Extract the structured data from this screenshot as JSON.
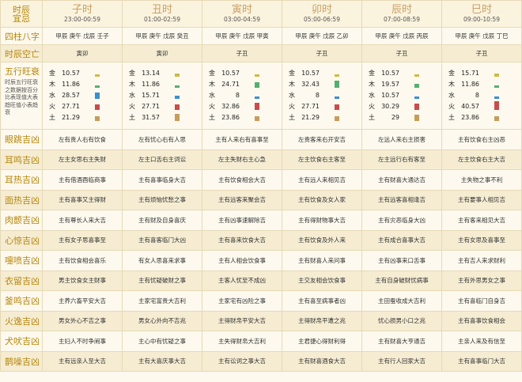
{
  "corner_label": [
    "时辰",
    "宜忌"
  ],
  "hours": [
    {
      "name": "子时",
      "range": "23:00-00:59",
      "bazi": "甲辰 庚午 戊辰 壬子",
      "kongwang": "寅卯",
      "wuxing": [
        {
          "el": "金",
          "v": "10.57",
          "c": "#cdbb46",
          "f": 0.26
        },
        {
          "el": "木",
          "v": "11.86",
          "c": "#55b06e",
          "f": 0.29
        },
        {
          "el": "水",
          "v": "28.57",
          "c": "#3b8fd1",
          "f": 0.7
        },
        {
          "el": "火",
          "v": "27.71",
          "c": "#c84c4c",
          "f": 0.68
        },
        {
          "el": "土",
          "v": "21.29",
          "c": "#c89c5c",
          "f": 0.52
        }
      ]
    },
    {
      "name": "丑时",
      "range": "01:00-02:59",
      "bazi": "甲辰 庚午 戊辰 癸丑",
      "kongwang": "寅卯",
      "wuxing": [
        {
          "el": "金",
          "v": "13.14",
          "c": "#cdbb46",
          "f": 0.32
        },
        {
          "el": "木",
          "v": "11.86",
          "c": "#55b06e",
          "f": 0.29
        },
        {
          "el": "水",
          "v": "15.71",
          "c": "#3b8fd1",
          "f": 0.39
        },
        {
          "el": "火",
          "v": "27.71",
          "c": "#c84c4c",
          "f": 0.68
        },
        {
          "el": "土",
          "v": "31.57",
          "c": "#c89c5c",
          "f": 0.78
        }
      ]
    },
    {
      "name": "寅时",
      "range": "03:00-04:59",
      "bazi": "甲辰 庚午 戊辰 甲寅",
      "kongwang": "子丑",
      "wuxing": [
        {
          "el": "金",
          "v": "10.57",
          "c": "#cdbb46",
          "f": 0.26
        },
        {
          "el": "木",
          "v": "24.71",
          "c": "#55b06e",
          "f": 0.61
        },
        {
          "el": "水",
          "v": "8",
          "c": "#3b8fd1",
          "f": 0.2
        },
        {
          "el": "火",
          "v": "32.86",
          "c": "#c84c4c",
          "f": 0.81
        },
        {
          "el": "土",
          "v": "23.86",
          "c": "#c89c5c",
          "f": 0.59
        }
      ]
    },
    {
      "name": "卯时",
      "range": "05:00-06:59",
      "bazi": "甲辰 庚午 戊辰 乙卯",
      "kongwang": "子丑",
      "wuxing": [
        {
          "el": "金",
          "v": "10.57",
          "c": "#cdbb46",
          "f": 0.26
        },
        {
          "el": "木",
          "v": "32.43",
          "c": "#55b06e",
          "f": 0.8
        },
        {
          "el": "水",
          "v": "8",
          "c": "#3b8fd1",
          "f": 0.2
        },
        {
          "el": "火",
          "v": "27.71",
          "c": "#c84c4c",
          "f": 0.68
        },
        {
          "el": "土",
          "v": "21.29",
          "c": "#c89c5c",
          "f": 0.52
        }
      ]
    },
    {
      "name": "辰时",
      "range": "07:00-08:59",
      "bazi": "甲辰 庚午 戊辰 丙辰",
      "kongwang": "子丑",
      "wuxing": [
        {
          "el": "金",
          "v": "10.57",
          "c": "#cdbb46",
          "f": 0.26
        },
        {
          "el": "木",
          "v": "19.57",
          "c": "#55b06e",
          "f": 0.48
        },
        {
          "el": "水",
          "v": "10.57",
          "c": "#3b8fd1",
          "f": 0.26
        },
        {
          "el": "火",
          "v": "30.29",
          "c": "#c84c4c",
          "f": 0.75
        },
        {
          "el": "土",
          "v": "29",
          "c": "#c89c5c",
          "f": 0.71
        }
      ]
    },
    {
      "name": "巳时",
      "range": "09:00-10:59",
      "bazi": "甲辰 庚午 戊辰 丁巳",
      "kongwang": "子丑",
      "wuxing": [
        {
          "el": "金",
          "v": "15.71",
          "c": "#cdbb46",
          "f": 0.39
        },
        {
          "el": "木",
          "v": "11.86",
          "c": "#55b06e",
          "f": 0.29
        },
        {
          "el": "水",
          "v": "8",
          "c": "#3b8fd1",
          "f": 0.2
        },
        {
          "el": "火",
          "v": "40.57",
          "c": "#c84c4c",
          "f": 1.0
        },
        {
          "el": "土",
          "v": "23.86",
          "c": "#c89c5c",
          "f": 0.59
        }
      ]
    }
  ],
  "row_labels": {
    "bazi": "四柱八字",
    "kongwang": "时辰空亡",
    "wuxing": "五行旺衰",
    "wuxing_note": "时辰五行旺衰之数据按百分比表现值大表趋旺值小表趋衰"
  },
  "rows": [
    {
      "label": "眼跳吉凶",
      "cells": [
        "左有贵人右有饮食",
        "左有忧心右有人思",
        "主有人来右有喜事至",
        "左贵客来右开安吉",
        "左远人来右主损害",
        "主有饮食右主凶恶"
      ]
    },
    {
      "label": "耳鸣吉凶",
      "cells": [
        "左主女思右主失财",
        "左主口舌右主词讼",
        "左主失财右主心急",
        "左主饮食右主客至",
        "左主远行右有客至",
        "左主饮食右主大吉"
      ]
    },
    {
      "label": "耳热吉凶",
      "cells": [
        "主有借酒酉临商事",
        "主有喜事临身大吉",
        "主有饮食相会大吉",
        "主有远人来相见吉",
        "主有财喜大通达吉",
        "主失物之事不利"
      ]
    },
    {
      "label": "面热吉凶",
      "cells": [
        "主有喜事又主得财",
        "主有烦恼忧愁之事",
        "主有远客来聚会吉",
        "主有饮食及女人家",
        "主有远客喜相逢吉",
        "主有要事人相见吉"
      ]
    },
    {
      "label": "肉颤吉凶",
      "cells": [
        "主有尊长人来大吉",
        "主有财及自身喜庆",
        "主有凶事速解除吉",
        "主有得财物事大吉",
        "主有灾恶临身大凶",
        "主有客来相见大吉"
      ]
    },
    {
      "label": "心惊吉凶",
      "cells": [
        "主有女子思喜事至",
        "主有喜客临门大凶",
        "主有喜来饮食大吉",
        "主有饮食及外人来",
        "主有成合喜事大吉",
        "主有女思及喜事至"
      ]
    },
    {
      "label": "嚏喷吉凶",
      "cells": [
        "主有饮食相会喜乐",
        "有女人思喜来求事",
        "主有人相会饮食事",
        "主有财喜人来问事",
        "主有凶事来口舌事",
        "主有吉人来求财利"
      ]
    },
    {
      "label": "衣留吉凶",
      "cells": [
        "男主饮食女主财事",
        "主有忧疑破财之事",
        "主客人忧至不成凶",
        "主交友相会饮食事",
        "主有自身破财忧病事",
        "主有外思男女之事"
      ]
    },
    {
      "label": "釜鸣吉凶",
      "cells": [
        "主养六畜平安大吉",
        "主家宅富贵大吉利",
        "主家宅有凶险之事",
        "主有喜至病事者凶",
        "主田蚕收成大吉利",
        "主有喜临门自身吉"
      ]
    },
    {
      "label": "火逸吉凶",
      "cells": [
        "男女外心不吉之事",
        "男女心外向不吉兆",
        "主得财帛平安大吉",
        "主得财帛平遭之兆",
        "忧心损男小口之兆",
        "主有喜事饮食相会"
      ]
    },
    {
      "label": "犬吠吉凶",
      "cells": [
        "主妇人不时争闹事",
        "主心中有忧疑之事",
        "主失得财帛大吉利",
        "主君捷心得财利得",
        "主有财喜大亨通吉",
        "主亲人来及有信至"
      ]
    },
    {
      "label": "鹊噪吉凶",
      "cells": [
        "主有远亲人至大吉",
        "主有大喜庆事大吉",
        "主有讼词之事大吉",
        "主有财喜酒食大吉",
        "主有行人回家大吉",
        "主有喜事临门大吉"
      ]
    }
  ]
}
